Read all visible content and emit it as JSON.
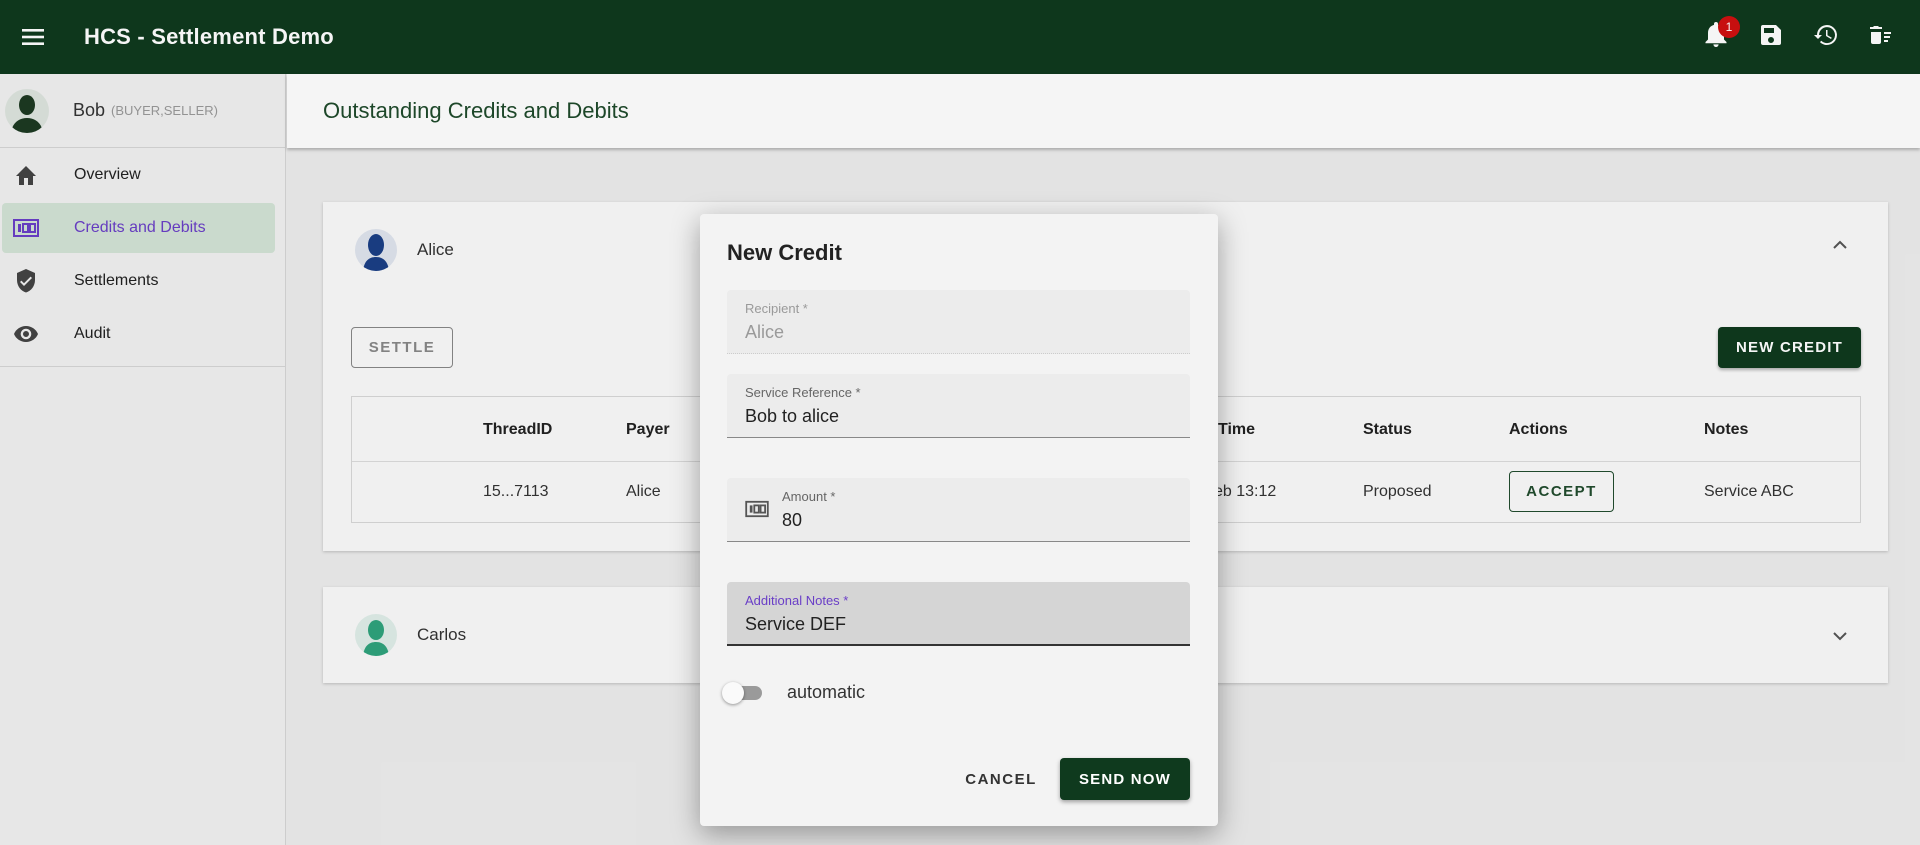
{
  "app": {
    "title": "HCS - Settlement Demo",
    "notification_count": "1",
    "colors": {
      "primary": "#0f3a1e",
      "accent": "#6a3fc7",
      "badge": "#d01010"
    }
  },
  "appbar_icons": [
    "menu-icon",
    "bell-icon",
    "save-icon",
    "history-icon",
    "delete-sweep-icon"
  ],
  "user": {
    "name": "Bob",
    "roles": "(BUYER,SELLER)"
  },
  "nav": [
    {
      "label": "Overview",
      "icon": "home-icon"
    },
    {
      "label": "Credits and Debits",
      "icon": "money-icon",
      "active": true
    },
    {
      "label": "Settlements",
      "icon": "shield-check-icon"
    },
    {
      "label": "Audit",
      "icon": "eye-icon"
    }
  ],
  "page": {
    "title": "Outstanding Credits and Debits"
  },
  "cards": [
    {
      "name": "Alice",
      "settle_label": "SETTLE",
      "new_credit_label": "NEW CREDIT",
      "table": {
        "headers": {
          "thread_id": "ThreadID",
          "payer": "Payer",
          "time": "Time",
          "status": "Status",
          "actions": "Actions",
          "notes": "Notes"
        },
        "rows": [
          {
            "thread_id": "15...7113",
            "payer": "Alice",
            "time": "eb 13:12",
            "status": "Proposed",
            "action": "ACCEPT",
            "notes": "Service ABC"
          }
        ]
      }
    },
    {
      "name": "Carlos"
    }
  ],
  "dialog": {
    "title": "New Credit",
    "recipient": {
      "label": "Recipient *",
      "value": "Alice"
    },
    "service_reference": {
      "label": "Service Reference *",
      "value": "Bob to alice"
    },
    "amount": {
      "label": "Amount *",
      "value": "80"
    },
    "notes": {
      "label": "Additional Notes *",
      "value": "Service DEF"
    },
    "toggle_label": "automatic",
    "cancel_label": "CANCEL",
    "send_label": "SEND NOW"
  }
}
